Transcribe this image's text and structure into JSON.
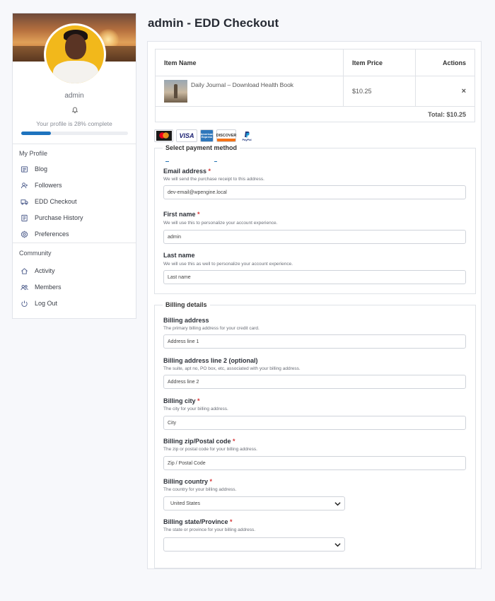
{
  "page": {
    "title": "admin - EDD Checkout"
  },
  "profile": {
    "username": "admin",
    "progress_text": "Your profile is 28% complete",
    "progress_percent": 28
  },
  "sidebar": {
    "my_profile_title": "My Profile",
    "my_profile_items": [
      {
        "label": "Blog",
        "icon": "blog-icon"
      },
      {
        "label": "Followers",
        "icon": "followers-icon"
      },
      {
        "label": "EDD Checkout",
        "icon": "truck-icon"
      },
      {
        "label": "Purchase History",
        "icon": "history-icon"
      },
      {
        "label": "Preferences",
        "icon": "gear-icon"
      }
    ],
    "community_title": "Community",
    "community_items": [
      {
        "label": "Activity",
        "icon": "home-icon"
      },
      {
        "label": "Members",
        "icon": "members-icon"
      },
      {
        "label": "Log Out",
        "icon": "power-icon"
      }
    ]
  },
  "cart": {
    "headers": {
      "name": "Item Name",
      "price": "Item Price",
      "actions": "Actions"
    },
    "items": [
      {
        "name": "Daily Journal – Download Health Book",
        "price": "$10.25",
        "remove": "×"
      }
    ],
    "total": "Total: $10.25"
  },
  "payment_icons": [
    "Mastercard",
    "VISA",
    "American Express",
    "DISCOVER",
    "PayPal"
  ],
  "payment_section": {
    "legend": "Select payment method",
    "email": {
      "label": "Email address",
      "desc": "We will send the purchase receipt to this address.",
      "value": "dev-email@wpengine.local"
    },
    "first_name": {
      "label": "First name",
      "desc": "We will use this to personalize your account experience.",
      "value": "admin"
    },
    "last_name": {
      "label": "Last name",
      "desc": "We will use this as well to personalize your account experience.",
      "placeholder": "Last name"
    }
  },
  "billing": {
    "legend": "Billing details",
    "address": {
      "label": "Billing address",
      "desc": "The primary billing address for your credit card.",
      "placeholder": "Address line 1"
    },
    "address2": {
      "label": "Billing address line 2 (optional)",
      "desc": "The suite, apt no, PO box, etc, associated with your billing address.",
      "placeholder": "Address line 2"
    },
    "city": {
      "label": "Billing city",
      "desc": "The city for your billing address.",
      "placeholder": "City"
    },
    "zip": {
      "label": "Billing zip/Postal code",
      "desc": "The zip or postal code for your billing address.",
      "placeholder": "Zip / Postal Code"
    },
    "country": {
      "label": "Billing country",
      "desc": "The country for your billing address.",
      "selected": "United States"
    },
    "state": {
      "label": "Billing state/Province",
      "desc": "The state or province for your billing address.",
      "selected": ""
    }
  },
  "colors": {
    "accent": "#1e73be",
    "required": "#d63638",
    "avatar_bg": "#f2b81b"
  }
}
